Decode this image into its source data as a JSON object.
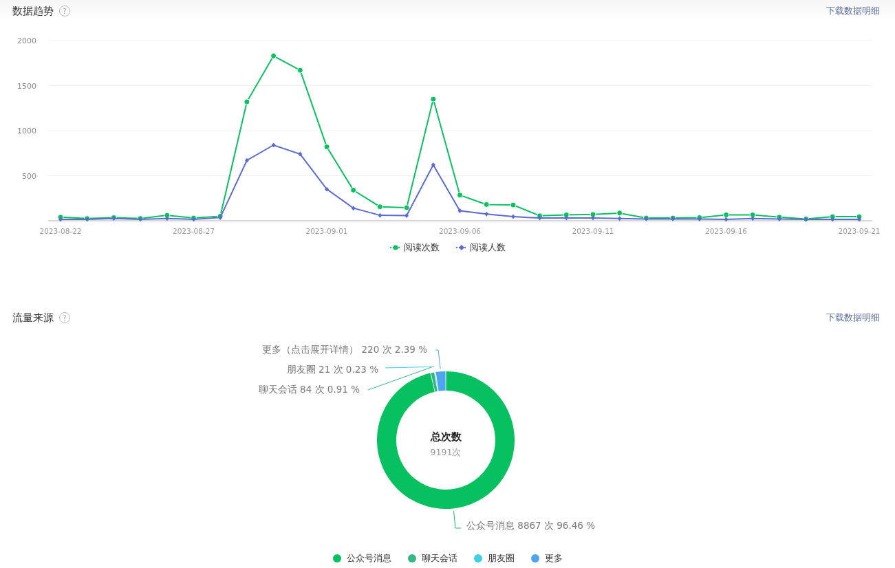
{
  "trend": {
    "title": "数据趋势",
    "help": "?",
    "download": "下载数据明细",
    "chart_data": {
      "type": "line",
      "categories": [
        "2023-08-22",
        null,
        null,
        null,
        null,
        "2023-08-27",
        null,
        null,
        null,
        null,
        "2023-09-01",
        null,
        null,
        null,
        null,
        "2023-09-06",
        null,
        null,
        null,
        null,
        "2023-09-11",
        null,
        null,
        null,
        null,
        "2023-09-16",
        null,
        null,
        null,
        null,
        "2023-09-21"
      ],
      "series": [
        {
          "name": "阅读次数",
          "color": "#07c160",
          "marker": "circle",
          "values": [
            40,
            25,
            35,
            25,
            60,
            30,
            50,
            1320,
            1830,
            1670,
            820,
            340,
            155,
            145,
            1350,
            285,
            180,
            175,
            55,
            65,
            70,
            85,
            30,
            30,
            35,
            65,
            65,
            40,
            20,
            45,
            45
          ]
        },
        {
          "name": "阅读人数",
          "color": "#5b6bd1",
          "marker": "diamond",
          "values": [
            15,
            15,
            25,
            15,
            25,
            15,
            35,
            670,
            840,
            740,
            350,
            140,
            60,
            58,
            620,
            110,
            75,
            45,
            30,
            30,
            30,
            25,
            20,
            20,
            20,
            15,
            25,
            20,
            15,
            15,
            15
          ]
        }
      ],
      "grid": true,
      "ylim": [
        0,
        2000
      ],
      "yticks": [
        500,
        1000,
        1500,
        2000
      ]
    }
  },
  "source": {
    "title": "流量来源",
    "help": "?",
    "download": "下载数据明细",
    "center_title": "总次数",
    "center_value": "9191次",
    "chart_data": {
      "type": "donut",
      "categories": [
        "公众号消息",
        "聊天会话",
        "朋友圈",
        "更多"
      ],
      "values": [
        8867,
        84,
        21,
        220
      ],
      "value_labels": [
        "公众号消息 8867 次 96.46 %",
        "聊天会话 84 次 0.91 %",
        "朋友圈 21 次 0.23 %",
        "更多（点击展开详情） 220 次 2.39 %"
      ]
    },
    "legend": [
      {
        "color": "#07c160"
      },
      {
        "color": "#36b587"
      },
      {
        "color": "#3fcfe4"
      },
      {
        "color": "#4ea4ee"
      }
    ]
  }
}
